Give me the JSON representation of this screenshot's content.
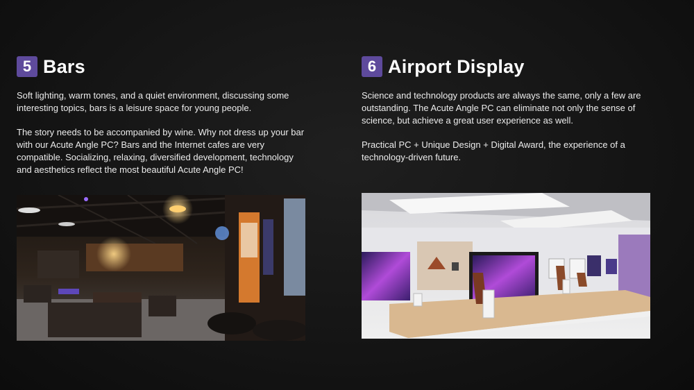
{
  "sections": [
    {
      "number": "5",
      "title": "Bars",
      "paragraphs": [
        "Soft lighting, warm tones, and a quiet environment, discussing some interesting topics, bars is a leisure space for young people.",
        "The story needs to be accompanied by wine. Why not dress up your bar with our Acute Angle PC? Bars and the Internet cafes are very compatible. Socializing, relaxing, diversified development, technology and aesthetics reflect the most beautiful Acute Angle PC!"
      ]
    },
    {
      "number": "6",
      "title": "Airport Display",
      "paragraphs": [
        "Science and technology products are always  the same, only a few are outstanding. The Acute Angle PC can eliminate not only the sense of science, but achieve a great user experience as well.",
        "Practical PC + Unique Design + Digital Award, the experience of a technology-driven future."
      ]
    }
  ],
  "colors": {
    "badge": "#5e4a9c",
    "background": "#141414",
    "text": "#ececec"
  }
}
